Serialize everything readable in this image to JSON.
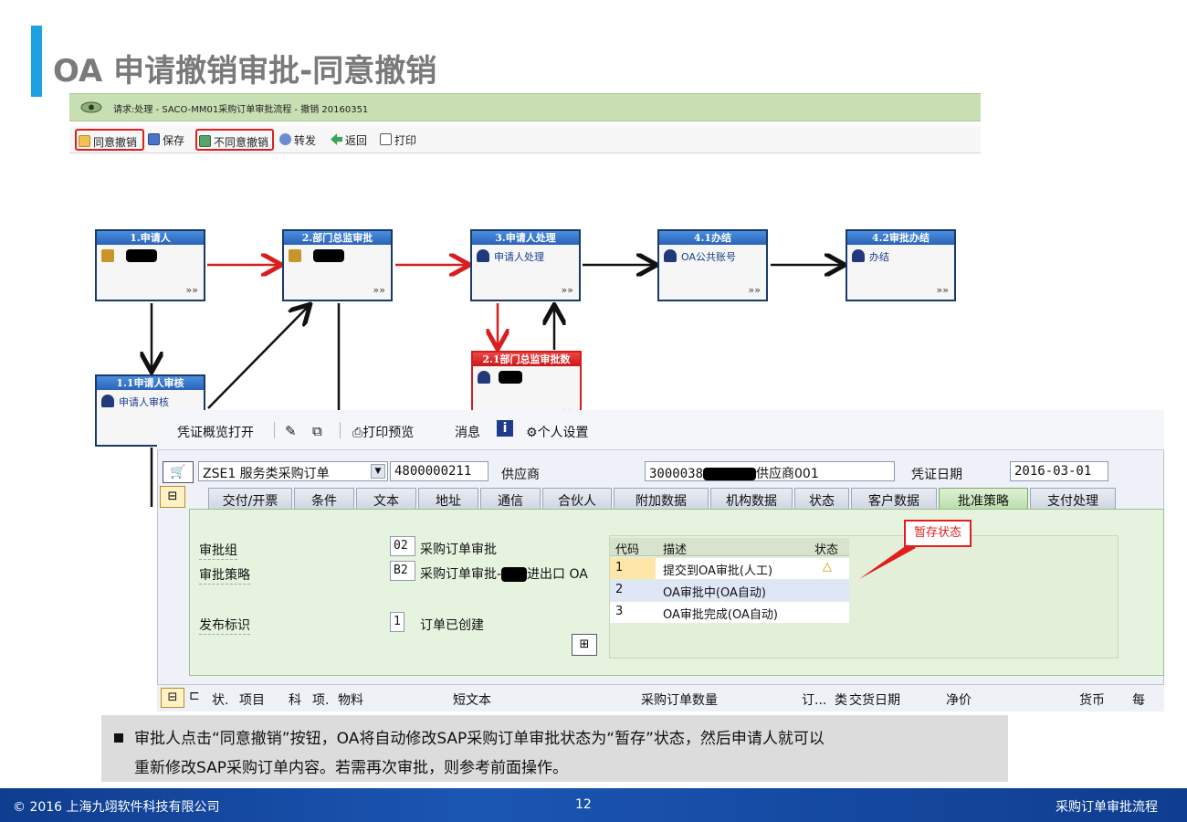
{
  "slide": {
    "title": "OA 申请撤销审批-同意撤销",
    "footer_left": "© 2016 上海九翊软件科技有限公司",
    "footer_page": "12",
    "footer_right": "采购订单审批流程"
  },
  "oa_window": {
    "header": "请求:处理 - SACO-MM01采购订单审批流程 - 撤销 20160351",
    "toolbar": [
      "同意撤销",
      "保存",
      "不同意撤销",
      "转发",
      "返回",
      "打印"
    ]
  },
  "workflow": {
    "nodes": [
      {
        "title": "1.申请人",
        "text": ""
      },
      {
        "title": "2.部门总监审批",
        "text": ""
      },
      {
        "title": "3.申请人处理",
        "text": "申请人处理"
      },
      {
        "title": "4.1办结",
        "text": "OA公共账号"
      },
      {
        "title": "4.2审批办结",
        "text": "办结"
      },
      {
        "title": "1.1申请人审核",
        "text": "申请人审核"
      },
      {
        "title": "2.1部门总监审批数",
        "text": ""
      }
    ],
    "more_glyph": "»»"
  },
  "sap": {
    "menu": [
      "凭证概览打开",
      "打印预览",
      "消息",
      "个人设置"
    ],
    "doc_type": "ZSE1 服务类采购订单",
    "po_number": "4800000211",
    "vendor_label": "供应商",
    "vendor_value_prefix": "3000038",
    "vendor_value_suffix": "供应商001",
    "doc_date_label": "凭证日期",
    "doc_date": "2016-03-01",
    "tabs": [
      "交付/开票",
      "条件",
      "文本",
      "地址",
      "通信",
      "合伙人",
      "附加数据",
      "机构数据",
      "状态",
      "客户数据",
      "批准策略",
      "支付处理"
    ],
    "active_tab": "批准策略",
    "release_group_label": "审批组",
    "release_group_code": "02",
    "release_group_desc": "采购订单审批",
    "release_strategy_label": "审批策略",
    "release_strategy_code": "B2",
    "release_strategy_desc_prefix": "采购订单审批-",
    "release_strategy_desc_suffix": "进出口 OA",
    "release_indicator_label": "发布标识",
    "release_indicator_code": "1",
    "release_indicator_desc": "订单已创建",
    "status_table": {
      "headers": [
        "代码",
        "描述",
        "状态"
      ],
      "rows": [
        {
          "code": "1",
          "desc": "提交到OA审批(人工)",
          "status": "△"
        },
        {
          "code": "2",
          "desc": "OA审批中(OA自动)",
          "status": ""
        },
        {
          "code": "3",
          "desc": "OA审批完成(OA自动)",
          "status": ""
        }
      ]
    },
    "item_headers": [
      "状.",
      "项目",
      "科",
      "项.",
      "物料",
      "短文本",
      "采购订单数量",
      "订...",
      "类",
      "交货日期",
      "净价",
      "货币",
      "每"
    ]
  },
  "callout": "暂存状态",
  "note": {
    "line1": "审批人点击“同意撤销”按钮，OA将自动修改SAP采购订单审批状态为“暂存”状态，然后申请人就可以",
    "line2": "重新修改SAP采购订单内容。若需再次审批，则参考前面操作。"
  }
}
